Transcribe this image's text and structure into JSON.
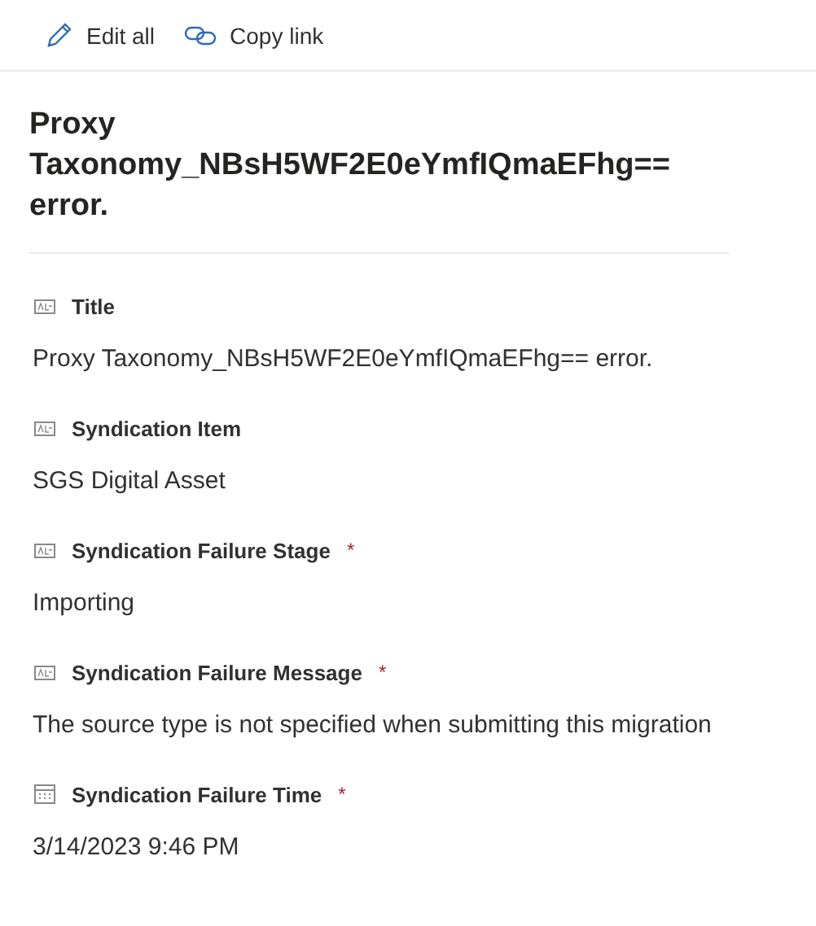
{
  "toolbar": [
    {
      "kind": "edit",
      "label": "Edit all"
    },
    {
      "kind": "link",
      "label": "Copy link"
    }
  ],
  "heading": "Proxy Taxonomy_NBsH5WF2E0eYmfIQmaEFhg== error.",
  "fields": [
    {
      "kind": "text",
      "label": "Title",
      "value": "Proxy Taxonomy_NBsH5WF2E0eYmfIQmaEFhg== error."
    },
    {
      "kind": "text",
      "label": "Syndication Item",
      "value": "SGS Digital Asset"
    },
    {
      "kind": "text",
      "label": "Syndication Failure Stage",
      "required_mark": "*",
      "value": "Importing"
    },
    {
      "kind": "text",
      "label": "Syndication Failure Message",
      "required_mark": "*",
      "value": "The source type is not specified when submitting this migration"
    },
    {
      "kind": "date",
      "label": "Syndication Failure Time",
      "required_mark": "*",
      "value": "3/14/2023 9:46 PM"
    }
  ]
}
